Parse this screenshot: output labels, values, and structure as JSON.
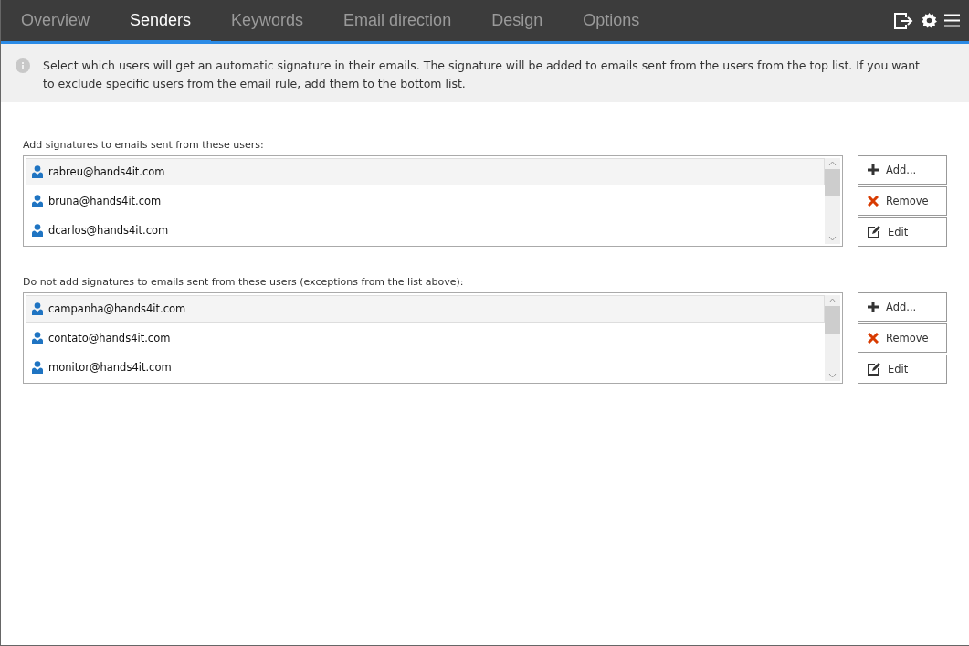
{
  "tabs": [
    {
      "label": "Overview",
      "selected": false
    },
    {
      "label": "Senders",
      "selected": true
    },
    {
      "label": "Keywords",
      "selected": false
    },
    {
      "label": "Email direction",
      "selected": false
    },
    {
      "label": "Design",
      "selected": false
    },
    {
      "label": "Options",
      "selected": false
    }
  ],
  "info": "Select which users will get an automatic signature in their emails. The signature will be added to emails sent from the users from the top list. If you want to exclude specific users from the email rule, add them to the bottom list.",
  "lists": [
    {
      "label": "Add signatures to emails sent from these users:",
      "users": [
        {
          "email": "rabreu@hands4it.com",
          "selected": true
        },
        {
          "email": "bruna@hands4it.com",
          "selected": false
        },
        {
          "email": "dcarlos@hands4it.com",
          "selected": false
        }
      ],
      "buttons": [
        {
          "kind": "add",
          "label": "Add..."
        },
        {
          "kind": "remove",
          "label": "Remove"
        },
        {
          "kind": "edit",
          "label": "Edit"
        }
      ]
    },
    {
      "label": "Do not add signatures to emails sent from these users (exceptions from the list above):",
      "users": [
        {
          "email": "campanha@hands4it.com",
          "selected": true
        },
        {
          "email": "contato@hands4it.com",
          "selected": false
        },
        {
          "email": "monitor@hands4it.com",
          "selected": false
        }
      ],
      "buttons": [
        {
          "kind": "add",
          "label": "Add..."
        },
        {
          "kind": "remove",
          "label": "Remove"
        },
        {
          "kind": "edit",
          "label": "Edit"
        }
      ]
    }
  ]
}
